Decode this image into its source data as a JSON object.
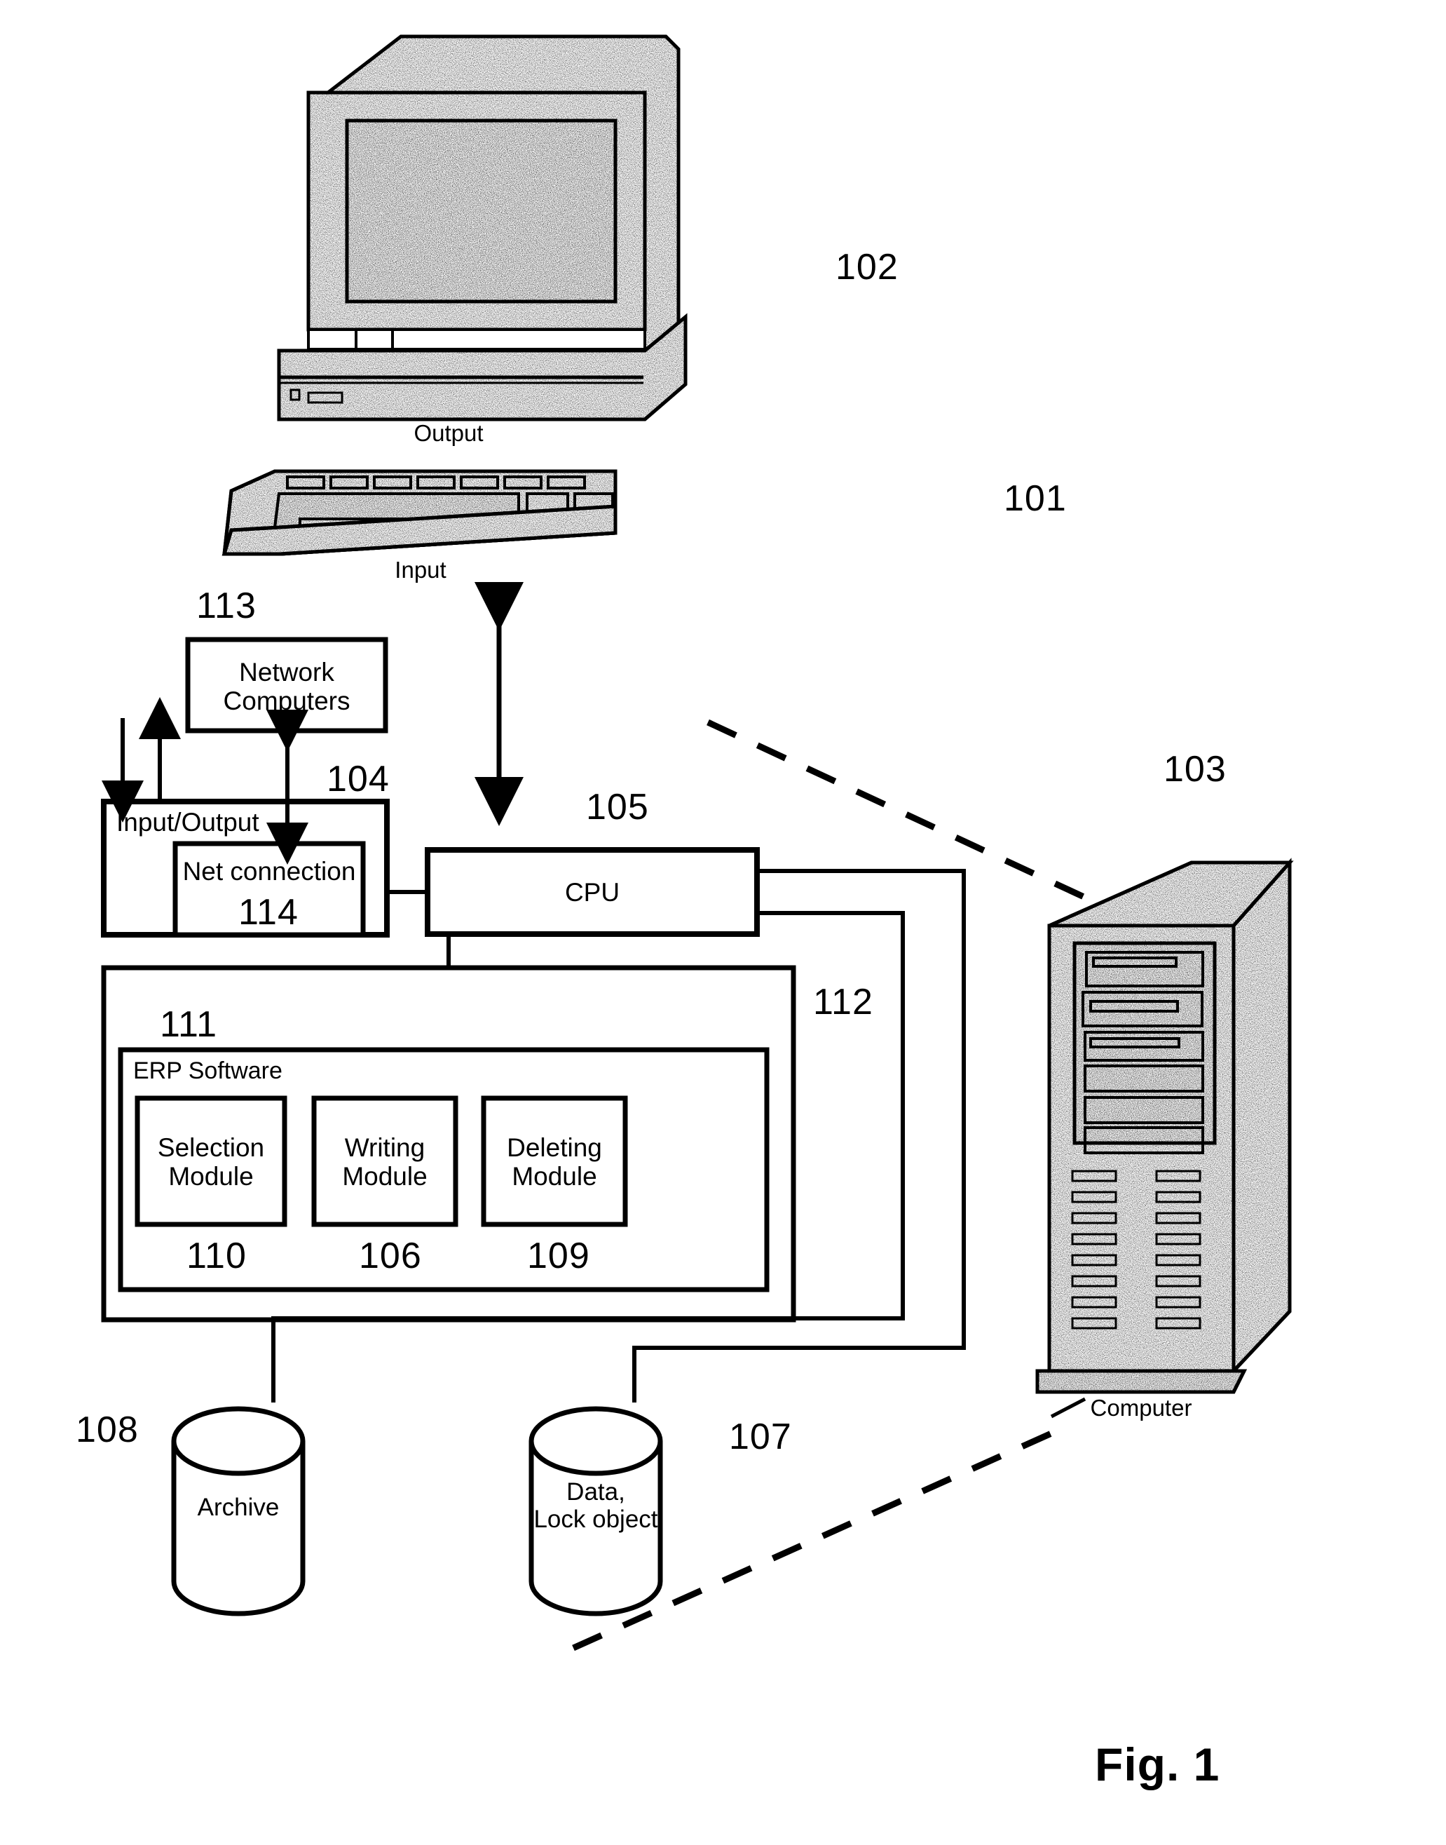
{
  "figure": {
    "caption": "Fig. 1"
  },
  "devices": [
    {
      "name": "monitor",
      "label": "Output",
      "reference": "102"
    },
    {
      "name": "keyboard",
      "label": "Input",
      "reference": "101"
    },
    {
      "name": "tower",
      "label": "Computer",
      "reference": "103"
    }
  ],
  "boxes": {
    "network_computers": {
      "label": "Network\nComputers",
      "reference": "113"
    },
    "input_output": {
      "label": "Input/Output",
      "reference": "104"
    },
    "net_connection": {
      "label": "Net connection",
      "reference": "114"
    },
    "cpu": {
      "label": "CPU",
      "reference": "105"
    },
    "memory_outer": {
      "reference": "112"
    },
    "memory_inner": {
      "reference": "111"
    },
    "erp_software": {
      "label": "ERP Software"
    }
  },
  "modules": [
    {
      "label": "Selection\nModule",
      "reference": "110"
    },
    {
      "label": "Writing\nModule",
      "reference": "106"
    },
    {
      "label": "Deleting\nModule",
      "reference": "109"
    }
  ],
  "stores": [
    {
      "name": "archive",
      "label": "Archive",
      "reference": "108"
    },
    {
      "name": "data-lock-object",
      "label": "Data,\nLock object",
      "reference": "107"
    }
  ],
  "colors": {
    "ink": "#000000",
    "paper": "#ffffff"
  }
}
